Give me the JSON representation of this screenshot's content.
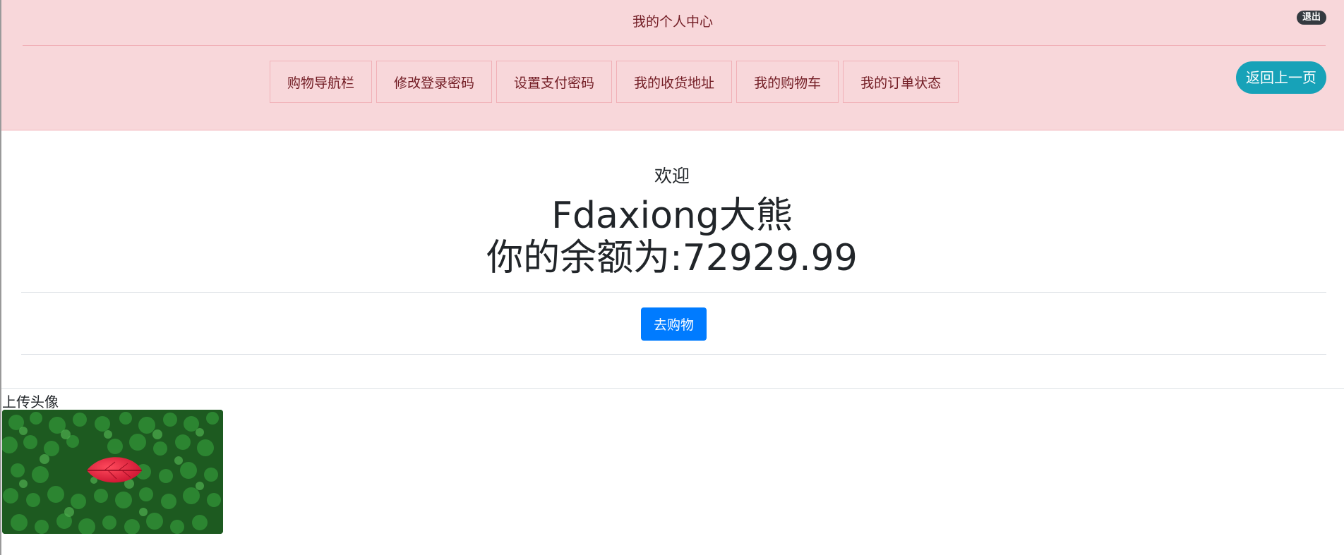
{
  "header": {
    "title": "我的个人中心",
    "logout_label": "退出",
    "back_label": "返回上一页",
    "nav": [
      {
        "label": "购物导航栏"
      },
      {
        "label": "修改登录密码"
      },
      {
        "label": "设置支付密码"
      },
      {
        "label": "我的收货地址"
      },
      {
        "label": "我的购物车"
      },
      {
        "label": "我的订单状态"
      }
    ]
  },
  "main": {
    "welcome": "欢迎",
    "username": "Fdaxiong大熊",
    "balance_label": "你的余额为:",
    "balance_value": "72929.99",
    "shop_button": "去购物",
    "upload_label": "上传头像"
  },
  "colors": {
    "header_bg": "#f8d7da",
    "header_text": "#721c24",
    "primary": "#007bff",
    "info": "#17a2b8",
    "dark": "#343a40"
  },
  "icons": {
    "avatar": "clover-field-red-leaf-image"
  }
}
